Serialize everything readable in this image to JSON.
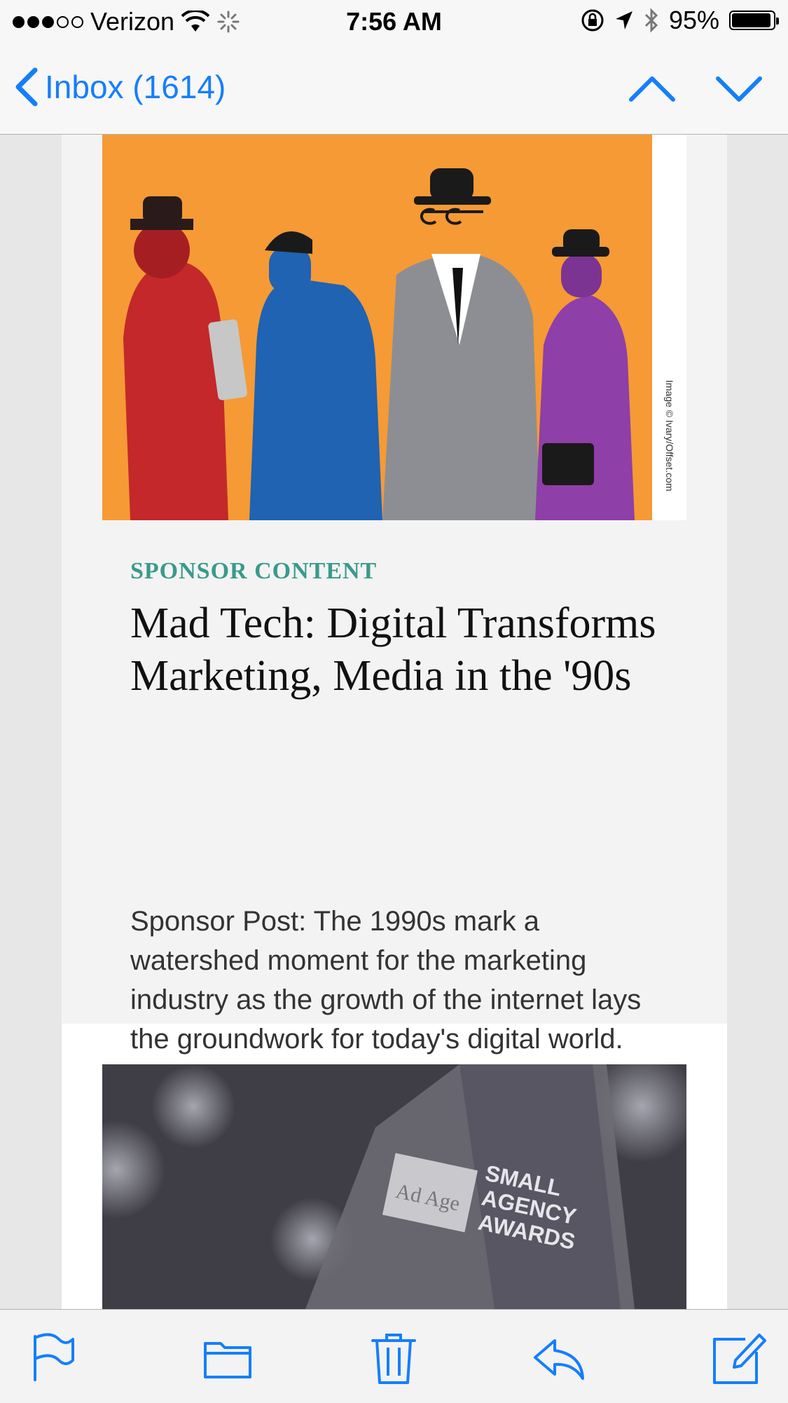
{
  "status_bar": {
    "carrier": "Verizon",
    "time": "7:56 AM",
    "battery_text": "95%",
    "battery_level": 0.95,
    "signal_bars_filled": 3,
    "signal_bars_total": 5
  },
  "nav": {
    "back_label": "Inbox (1614)"
  },
  "email": {
    "image_credit": "Image © Ivary/Offset.com",
    "sponsor_label": "SPONSOR CONTENT",
    "headline": "Mad Tech: Digital Transforms Marketing, Media in the '90s",
    "summary": "Sponsor Post: The 1990s mark a watershed moment for the marketing industry as the growth of the internet lays the groundwork for today's digital world.",
    "award_logo_text": "Ad Age",
    "award_title_line1": "SMALL",
    "award_title_line2": "AGENCY",
    "award_title_line3": "AWARDS"
  },
  "colors": {
    "ios_blue": "#157efb",
    "sponsor_green": "#3a9a8a",
    "hero_orange": "#f59a35"
  },
  "toolbar_icons": [
    "flag-icon",
    "folder-icon",
    "trash-icon",
    "reply-icon",
    "compose-icon"
  ]
}
